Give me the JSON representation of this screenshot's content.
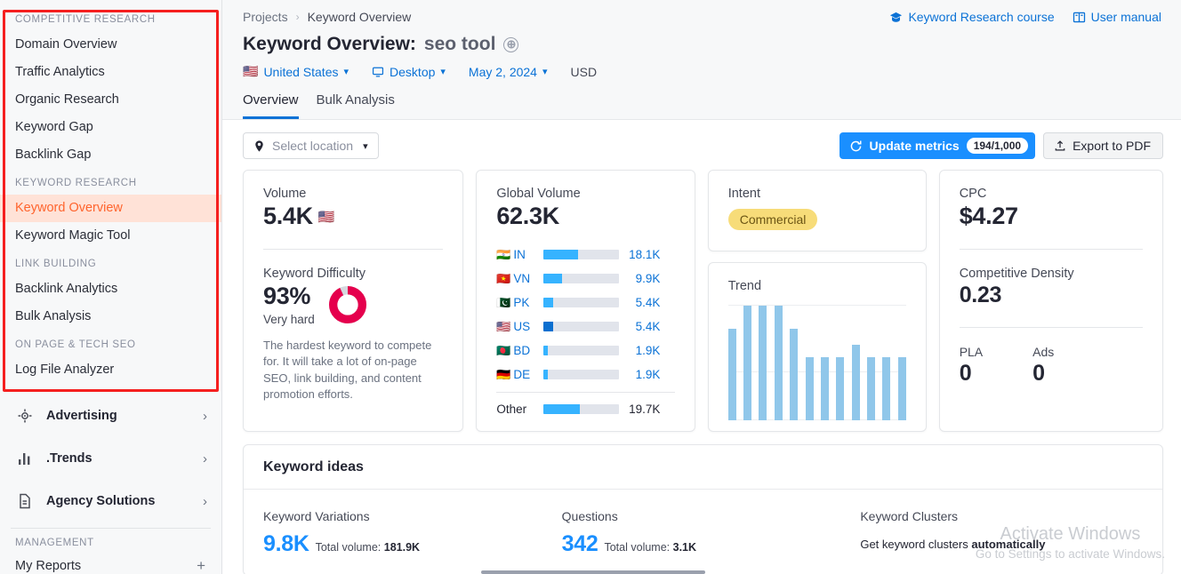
{
  "sidebar": {
    "groups": [
      {
        "title": "COMPETITIVE RESEARCH",
        "items": [
          {
            "label": "Domain Overview",
            "active": false
          },
          {
            "label": "Traffic Analytics",
            "active": false
          },
          {
            "label": "Organic Research",
            "active": false
          },
          {
            "label": "Keyword Gap",
            "active": false
          },
          {
            "label": "Backlink Gap",
            "active": false
          }
        ]
      },
      {
        "title": "KEYWORD RESEARCH",
        "items": [
          {
            "label": "Keyword Overview",
            "active": true
          },
          {
            "label": "Keyword Magic Tool",
            "active": false
          }
        ]
      },
      {
        "title": "LINK BUILDING",
        "items": [
          {
            "label": "Backlink Analytics",
            "active": false
          },
          {
            "label": "Bulk Analysis",
            "active": false
          }
        ]
      },
      {
        "title": "ON PAGE & TECH SEO",
        "items": [
          {
            "label": "Log File Analyzer",
            "active": false
          }
        ]
      }
    ],
    "big_nav": [
      {
        "label": "Advertising",
        "icon": "target-icon"
      },
      {
        "label": ".Trends",
        "icon": "bar-chart-icon"
      },
      {
        "label": "Agency Solutions",
        "icon": "document-icon"
      }
    ],
    "management": {
      "title": "MANAGEMENT",
      "items": [
        {
          "label": "My Reports",
          "action": "+"
        }
      ]
    }
  },
  "topbar": {
    "breadcrumb": {
      "root": "Projects",
      "separator": "›",
      "current": "Keyword Overview"
    },
    "help_links": [
      {
        "label": "Keyword Research course",
        "icon": "graduation-cap-icon"
      },
      {
        "label": "User manual",
        "icon": "book-icon"
      }
    ],
    "title_prefix": "Keyword Overview:",
    "keyword": "seo tool",
    "add_icon": "⊕",
    "meta": {
      "country": "United States",
      "country_flag": "🇺🇸",
      "device": "Desktop",
      "date": "May 2, 2024",
      "currency": "USD"
    },
    "tabs": [
      {
        "label": "Overview",
        "active": true
      },
      {
        "label": "Bulk Analysis",
        "active": false
      }
    ]
  },
  "toolbar": {
    "location_placeholder": "Select location",
    "update_label": "Update metrics",
    "update_count": "194/1,000",
    "export_label": "Export to PDF"
  },
  "cards": {
    "volume": {
      "label": "Volume",
      "value": "5.4K",
      "flag": "🇺🇸"
    },
    "keyword_difficulty": {
      "label": "Keyword Difficulty",
      "value": "93%",
      "percent": 93,
      "rating": "Very hard",
      "description": "The hardest keyword to compete for. It will take a lot of on-page SEO, link building, and content promotion efforts.",
      "color": "#e5004d"
    },
    "global_volume": {
      "label": "Global Volume",
      "value": "62.3K",
      "other_label": "Other",
      "other_value": "19.7K"
    },
    "intent": {
      "label": "Intent",
      "badge": "Commercial",
      "badge_bg": "#f7dc79",
      "badge_color": "#6b5514"
    },
    "trend": {
      "label": "Trend"
    },
    "cpc": {
      "label": "CPC",
      "value": "$4.27"
    },
    "competitive_density": {
      "label": "Competitive Density",
      "value": "0.23"
    },
    "pla": {
      "label": "PLA",
      "value": "0"
    },
    "ads": {
      "label": "Ads",
      "value": "0"
    }
  },
  "keyword_ideas": {
    "title": "Keyword ideas",
    "columns": [
      {
        "title": "Keyword Variations",
        "figure": "9.8K",
        "sub_label": "Total volume:",
        "sub_value": "181.9K"
      },
      {
        "title": "Questions",
        "figure": "342",
        "sub_label": "Total volume:",
        "sub_value": "3.1K"
      },
      {
        "title": "Keyword Clusters",
        "auto_prefix": "Get keyword clusters",
        "auto_bold": "automatically"
      }
    ]
  },
  "watermark": {
    "line1": "Activate Windows",
    "line2": "Go to Settings to activate Windows."
  },
  "chart_data": [
    {
      "type": "bar",
      "title": "Global Volume",
      "categories": [
        "IN",
        "VN",
        "PK",
        "US",
        "BD",
        "DE",
        "Other"
      ],
      "values": [
        18100,
        9900,
        5400,
        5400,
        1900,
        1900,
        19700
      ],
      "value_labels": [
        "18.1K",
        "9.9K",
        "5.4K",
        "5.4K",
        "1.9K",
        "1.9K",
        "19.7K"
      ],
      "flags": [
        "🇮🇳",
        "🇻🇳",
        "🇵🇰",
        "🇺🇸",
        "🇧🇩",
        "🇩🇪",
        ""
      ],
      "bar_pct": [
        46,
        24,
        13,
        13,
        5,
        5,
        48
      ],
      "highlight_index": 3,
      "xlabel": "",
      "ylabel": "",
      "grid": false,
      "legend": "none"
    },
    {
      "type": "bar",
      "title": "Trend",
      "categories": [
        "1",
        "2",
        "3",
        "4",
        "5",
        "6",
        "7",
        "8",
        "9",
        "10",
        "11",
        "12"
      ],
      "values": [
        80,
        100,
        100,
        100,
        80,
        55,
        55,
        55,
        66,
        55,
        55,
        55
      ],
      "ylim": [
        0,
        100
      ],
      "xlabel": "",
      "ylabel": "",
      "grid": true,
      "gridlines": [
        55,
        100
      ],
      "legend": "none",
      "color": "#90c7ea"
    },
    {
      "type": "pie",
      "title": "Keyword Difficulty",
      "categories": [
        "Difficulty",
        "Remaining"
      ],
      "values": [
        93,
        7
      ],
      "colors": [
        "#e5004d",
        "#d5d8de"
      ],
      "legend": "none"
    }
  ]
}
